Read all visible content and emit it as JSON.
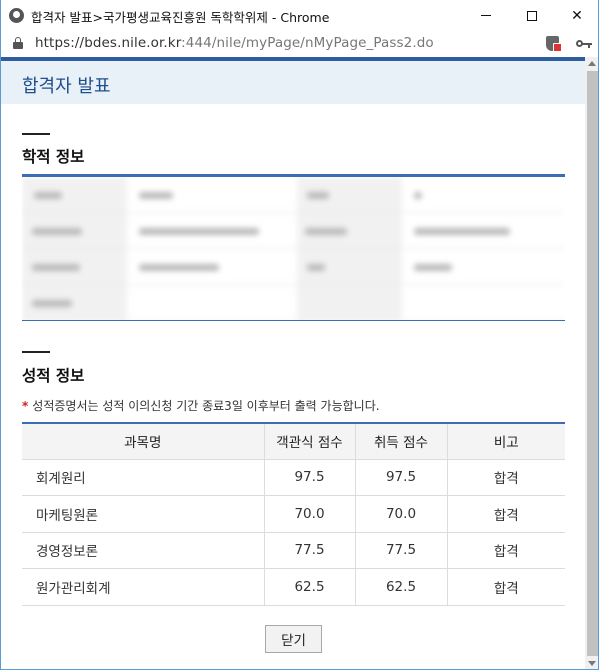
{
  "window": {
    "title": "합격자 발표>국가평생교육진흥원 독학학위제 - Chrome",
    "url_host": "https://bdes.nile.or.kr",
    "url_path": ":444/nile/myPage/nMyPage_Pass2.do"
  },
  "page": {
    "title": "합격자 발표"
  },
  "student_info": {
    "title": "학적 정보"
  },
  "grades": {
    "title": "성적 정보",
    "notice": "성적증명서는 성적 이의신청 기간 종료3일 이후부터 출력 가능합니다.",
    "headers": [
      "과목명",
      "객관식 점수",
      "취득 점수",
      "비고"
    ],
    "rows": [
      {
        "subject": "회계원리",
        "objective": "97.5",
        "earned": "97.5",
        "note": "합격"
      },
      {
        "subject": "마케팅원론",
        "objective": "70.0",
        "earned": "70.0",
        "note": "합격"
      },
      {
        "subject": "경영정보론",
        "objective": "77.5",
        "earned": "77.5",
        "note": "합격"
      },
      {
        "subject": "원가관리회계",
        "objective": "62.5",
        "earned": "62.5",
        "note": "합격"
      }
    ]
  },
  "buttons": {
    "close": "닫기"
  },
  "colors": {
    "accent": "#2d5d9f",
    "header_bg": "#e8f0f8",
    "title_blue": "#1f4e8c",
    "required_star": "#d21f1f"
  },
  "icons": [
    "chrome-icon",
    "lock-icon",
    "shield-icon",
    "key-icon",
    "minimize-icon",
    "maximize-icon",
    "close-icon"
  ]
}
